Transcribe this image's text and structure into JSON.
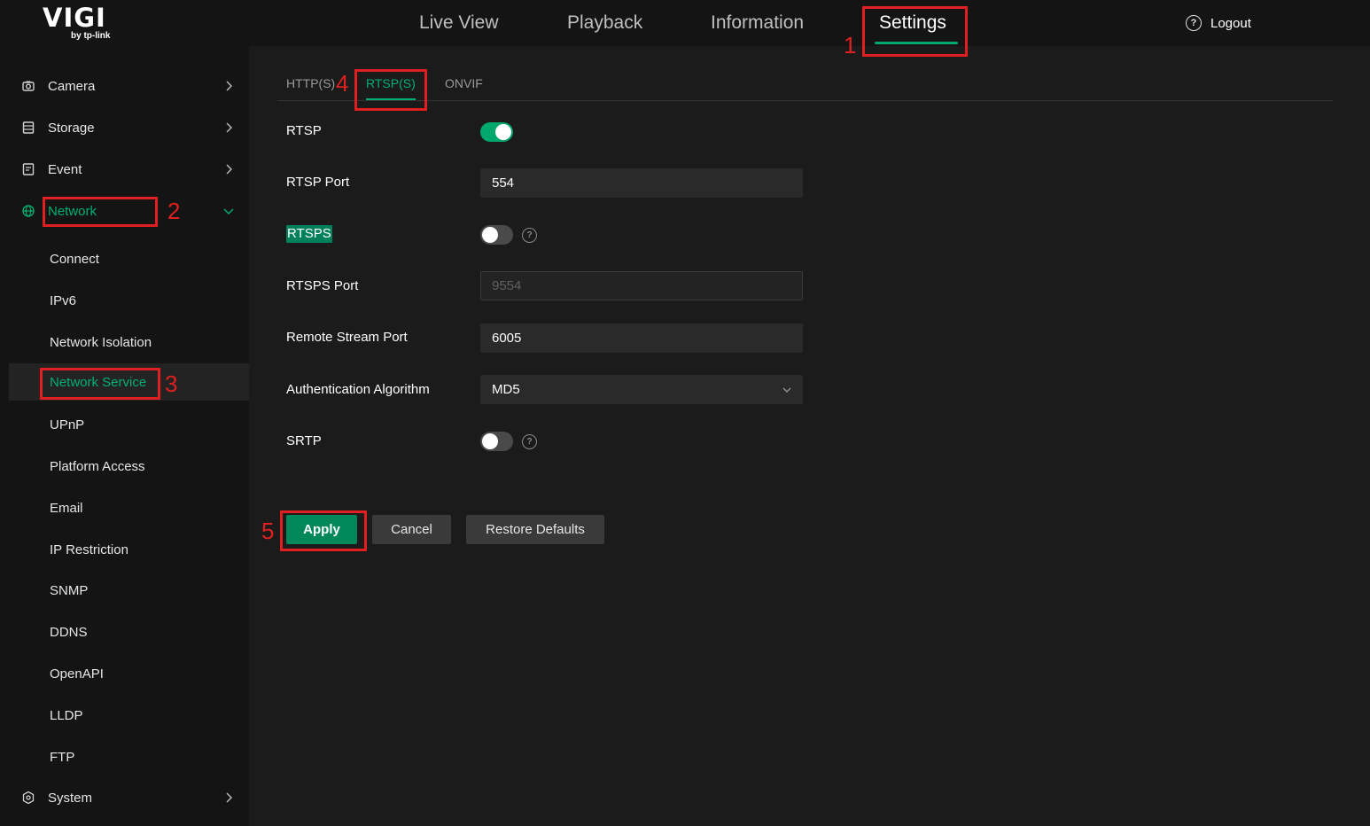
{
  "header": {
    "logo_text": "VIGI",
    "logo_sub": "by tp-link",
    "nav": [
      {
        "label": "Live View"
      },
      {
        "label": "Playback"
      },
      {
        "label": "Information"
      },
      {
        "label": "Settings",
        "active": true
      }
    ],
    "logout_label": "Logout"
  },
  "sidebar": {
    "items": [
      {
        "label": "Camera",
        "icon": "camera-icon"
      },
      {
        "label": "Storage",
        "icon": "storage-icon"
      },
      {
        "label": "Event",
        "icon": "event-icon"
      },
      {
        "label": "Network",
        "icon": "globe-icon",
        "expanded": true
      },
      {
        "label": "System",
        "icon": "system-icon"
      }
    ],
    "network_sub": [
      "Connect",
      "IPv6",
      "Network Isolation",
      "Network Service",
      "UPnP",
      "Platform Access",
      "Email",
      "IP Restriction",
      "SNMP",
      "DDNS",
      "OpenAPI",
      "LLDP",
      "FTP"
    ],
    "selected_sub": "Network Service"
  },
  "tabs": [
    {
      "label": "HTTP(S)"
    },
    {
      "label": "RTSP(S)",
      "active": true
    },
    {
      "label": "ONVIF"
    }
  ],
  "form": {
    "rtsp_label": "RTSP",
    "rtsp_enabled": true,
    "rtsp_port_label": "RTSP Port",
    "rtsp_port_value": "554",
    "rtsps_label": "RTSPS",
    "rtsps_enabled": false,
    "rtsps_port_label": "RTSPS Port",
    "rtsps_port_value": "9554",
    "remote_port_label": "Remote Stream Port",
    "remote_port_value": "6005",
    "auth_label": "Authentication Algorithm",
    "auth_value": "MD5",
    "srtp_label": "SRTP",
    "srtp_enabled": false
  },
  "buttons": {
    "apply": "Apply",
    "cancel": "Cancel",
    "restore": "Restore Defaults"
  },
  "annotations": {
    "n1": "1",
    "n2": "2",
    "n3": "3",
    "n4": "4",
    "n5": "5",
    "color": "#e02020"
  },
  "colors": {
    "accent": "#00b070",
    "header_bg": "#141414",
    "main_bg": "#1b1b1b"
  }
}
